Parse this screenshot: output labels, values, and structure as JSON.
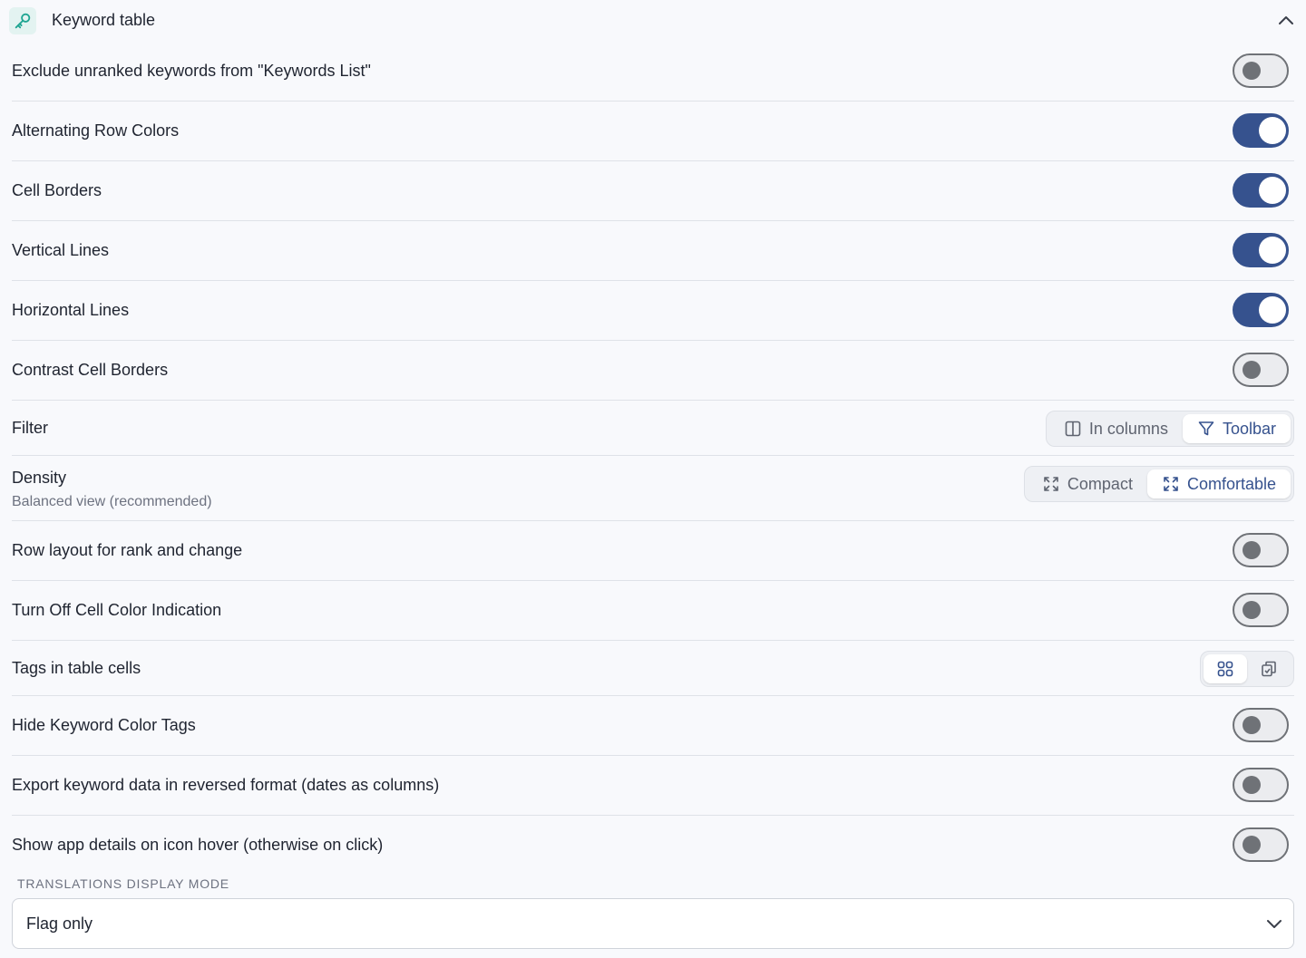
{
  "header": {
    "title": "Keyword table",
    "icon": "key-icon",
    "collapse_icon": "chevron-up-icon",
    "accent_color": "#36528e",
    "icon_color": "#1fa592"
  },
  "settings": {
    "exclude_unranked": {
      "label": "Exclude unranked keywords from \"Keywords List\"",
      "enabled": false
    },
    "alternating_rows": {
      "label": "Alternating Row Colors",
      "enabled": true
    },
    "cell_borders": {
      "label": "Cell Borders",
      "enabled": true
    },
    "vertical_lines": {
      "label": "Vertical Lines",
      "enabled": true
    },
    "horizontal_lines": {
      "label": "Horizontal Lines",
      "enabled": true
    },
    "contrast_borders": {
      "label": "Contrast Cell Borders",
      "enabled": false
    },
    "filter": {
      "label": "Filter",
      "options": [
        "In columns",
        "Toolbar"
      ],
      "selected": "Toolbar"
    },
    "density": {
      "label": "Density",
      "sublabel": "Balanced view (recommended)",
      "options": [
        "Compact",
        "Comfortable"
      ],
      "selected": "Comfortable"
    },
    "row_layout": {
      "label": "Row layout for rank and change",
      "enabled": false
    },
    "turn_off_color": {
      "label": "Turn Off Cell Color Indication",
      "enabled": false
    },
    "tags_in_cells": {
      "label": "Tags in table cells",
      "options": [
        "grid-icon",
        "copy-stack-icon"
      ],
      "selected": "grid-icon"
    },
    "hide_color_tags": {
      "label": "Hide Keyword Color Tags",
      "enabled": false
    },
    "export_reversed": {
      "label": "Export keyword data in reversed format (dates as columns)",
      "enabled": false
    },
    "app_details_hover": {
      "label": "Show app details on icon hover (otherwise on click)",
      "enabled": false
    }
  },
  "translations": {
    "section_label": "TRANSLATIONS DISPLAY MODE",
    "value": "Flag only"
  }
}
